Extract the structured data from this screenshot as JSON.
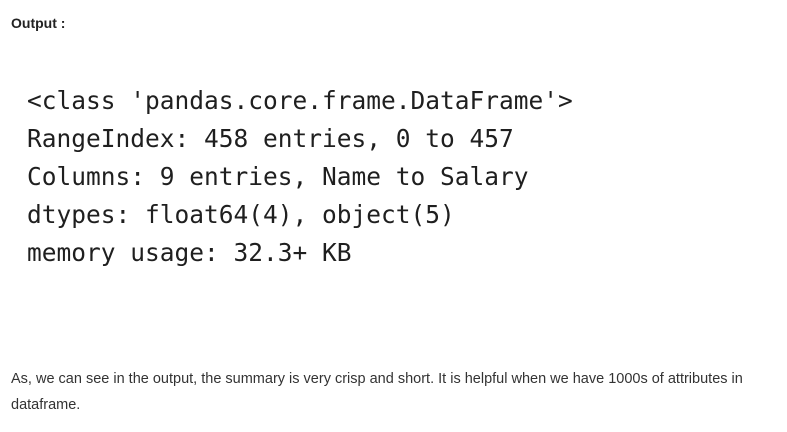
{
  "output_label": "Output :",
  "code_lines": [
    "<class 'pandas.core.frame.DataFrame'>",
    "RangeIndex: 458 entries, 0 to 457",
    "Columns: 9 entries, Name to Salary",
    "dtypes: float64(4), object(5)",
    "memory usage: 32.3+ KB"
  ],
  "explanation": "As, we can see in the output, the summary is very crisp and short. It is helpful when we have 1000s of attributes in dataframe."
}
